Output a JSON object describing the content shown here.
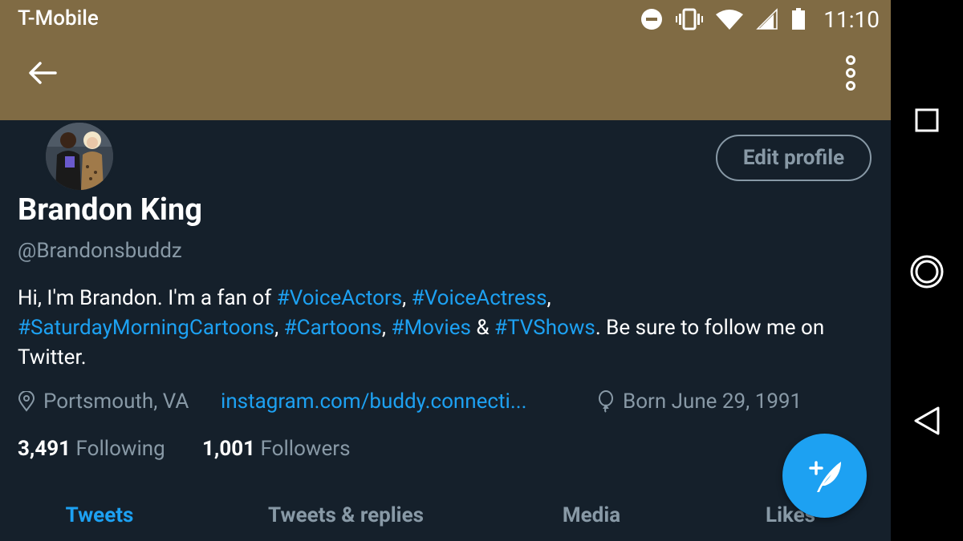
{
  "status_bar": {
    "carrier": "T-Mobile",
    "time": "11:10",
    "icons": [
      "do-not-disturb-icon",
      "vibrate-icon",
      "wifi-icon",
      "cell-signal-icon",
      "battery-icon"
    ]
  },
  "header": {
    "color": "#806b44",
    "back_icon": "back-arrow-icon",
    "menu_icon": "more-vertical-icon"
  },
  "profile": {
    "edit_label": "Edit profile",
    "name": "Brandon King",
    "handle": "@Brandonsbuddz",
    "bio": {
      "t1": "Hi, I'm Brandon. I'm a fan of ",
      "h1": "#VoiceActors",
      "t2": ", ",
      "h2": "#VoiceActress",
      "t3": ", ",
      "h3": "#SaturdayMorningCartoons",
      "t4": ", ",
      "h4": "#Cartoons",
      "t5": ", ",
      "h5": "#Movies",
      "t6": " & ",
      "h6": "#TVShows",
      "t7": ". Be sure to follow me on Twitter."
    },
    "location": "Portsmouth, VA",
    "link": "instagram.com/buddy.connecti...",
    "born": "Born June 29, 1991",
    "following_count": "3,491",
    "following_label": "Following",
    "followers_count": "1,001",
    "followers_label": "Followers"
  },
  "tabs": [
    {
      "label": "Tweets",
      "active": true
    },
    {
      "label": "Tweets & replies",
      "active": false
    },
    {
      "label": "Media",
      "active": false
    },
    {
      "label": "Likes",
      "active": false
    }
  ],
  "fab_icon": "compose-tweet-icon",
  "colors": {
    "background": "#15202b",
    "accent": "#1da1f2",
    "secondary_text": "#8899a6"
  },
  "nav_bar": [
    "recents-square-icon",
    "home-circle-icon",
    "back-triangle-icon"
  ]
}
